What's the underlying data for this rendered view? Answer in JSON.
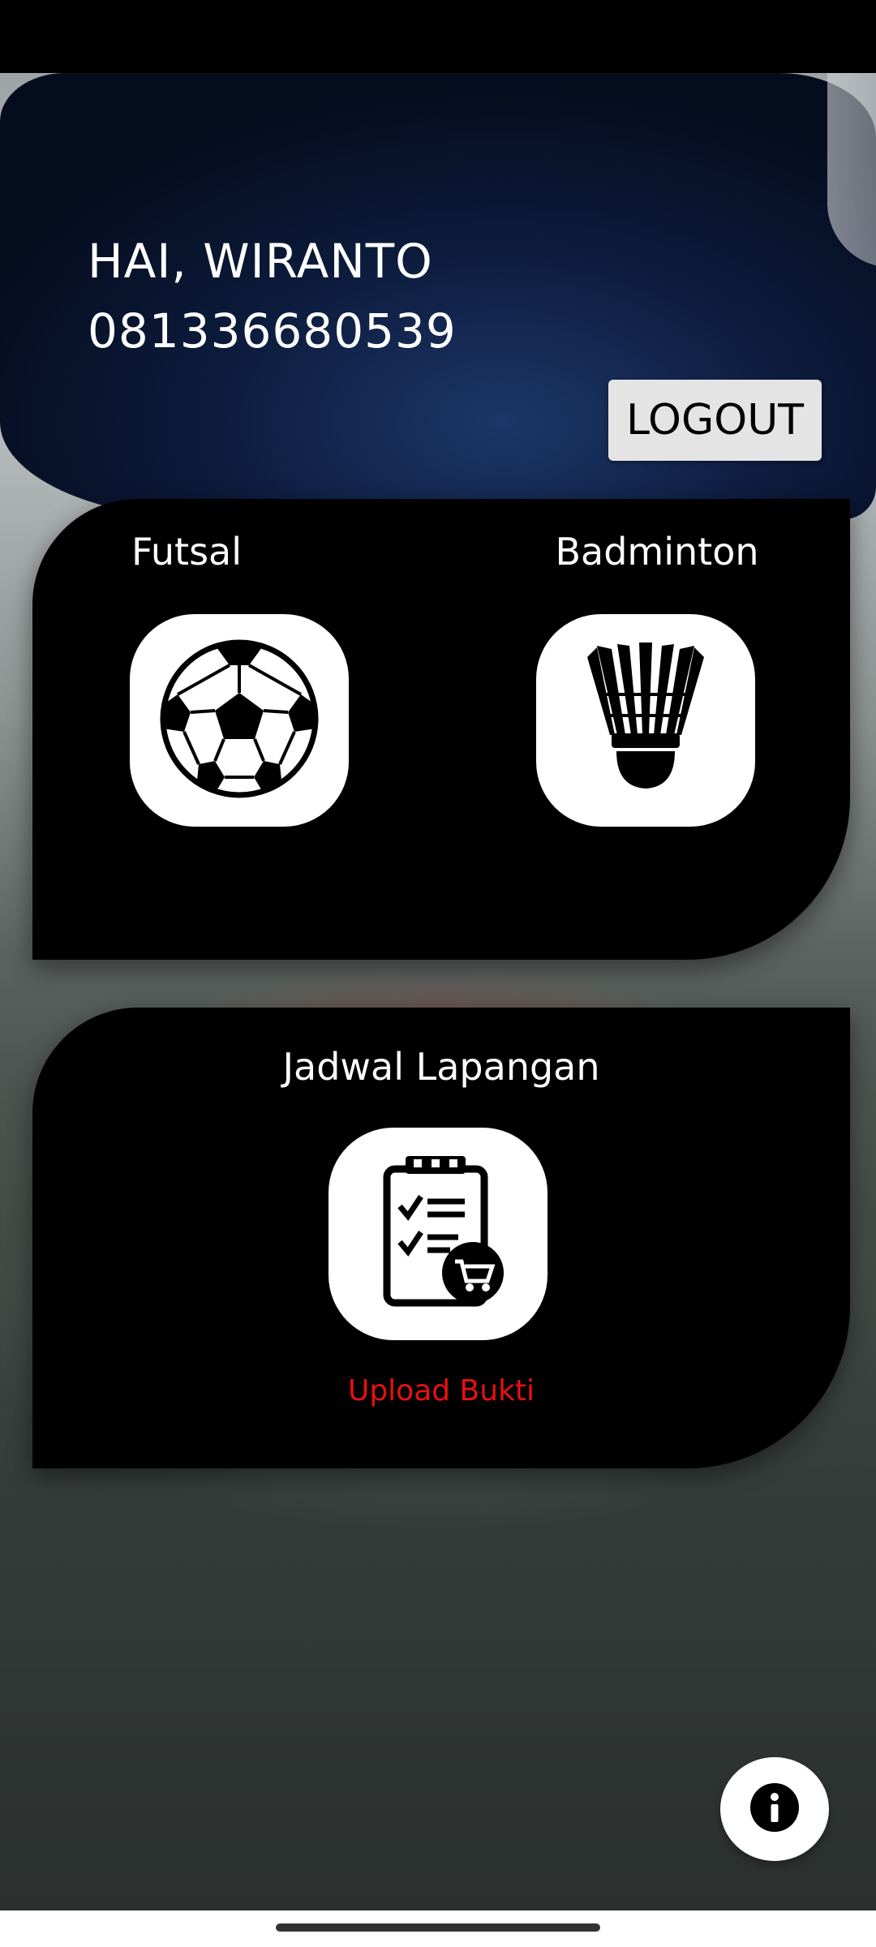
{
  "header": {
    "greeting": "HAI, WIRANTO",
    "phone": "081336680539",
    "logout_label": "LOGOUT"
  },
  "sports": [
    {
      "label": "Futsal",
      "icon": "soccer-ball-icon"
    },
    {
      "label": "Badminton",
      "icon": "shuttlecock-icon"
    }
  ],
  "schedule": {
    "title": "Jadwal Lapangan",
    "icon": "clipboard-cart-icon",
    "upload_label": "Upload Bukti"
  },
  "fab": {
    "icon": "info-icon"
  },
  "colors": {
    "header_navy": "#0c1a3a",
    "card_bg": "#000000",
    "upload_text": "#e8110f",
    "tile_bg": "#ffffff"
  }
}
